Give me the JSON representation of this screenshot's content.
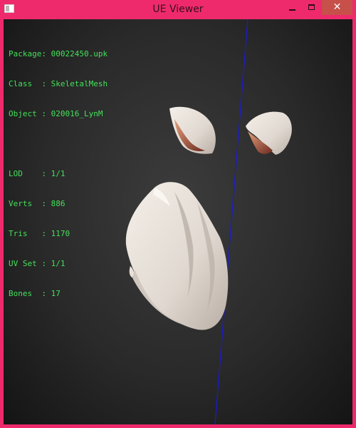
{
  "window": {
    "title": "UE Viewer",
    "close_glyph": "✕",
    "accent": "#ee2a6c"
  },
  "info": {
    "package": {
      "label": "Package:",
      "value": "00022450.upk"
    },
    "class": {
      "label": "Class  :",
      "value": "SkeletalMesh"
    },
    "object": {
      "label": "Object :",
      "value": "020016_LynM"
    },
    "lod": {
      "label": "LOD    :",
      "value": "1/1"
    },
    "verts": {
      "label": "Verts  :",
      "value": "886"
    },
    "tris": {
      "label": "Tris   :",
      "value": "1170"
    },
    "uvset": {
      "label": "UV Set :",
      "value": "1/1"
    },
    "bones": {
      "label": "Bones  :",
      "value": "17"
    }
  },
  "colors": {
    "info_text": "#44e05a",
    "axis_line": "#1a1adc"
  },
  "icons": [
    "app-icon",
    "minimize-icon",
    "maximize-icon",
    "close-icon"
  ]
}
